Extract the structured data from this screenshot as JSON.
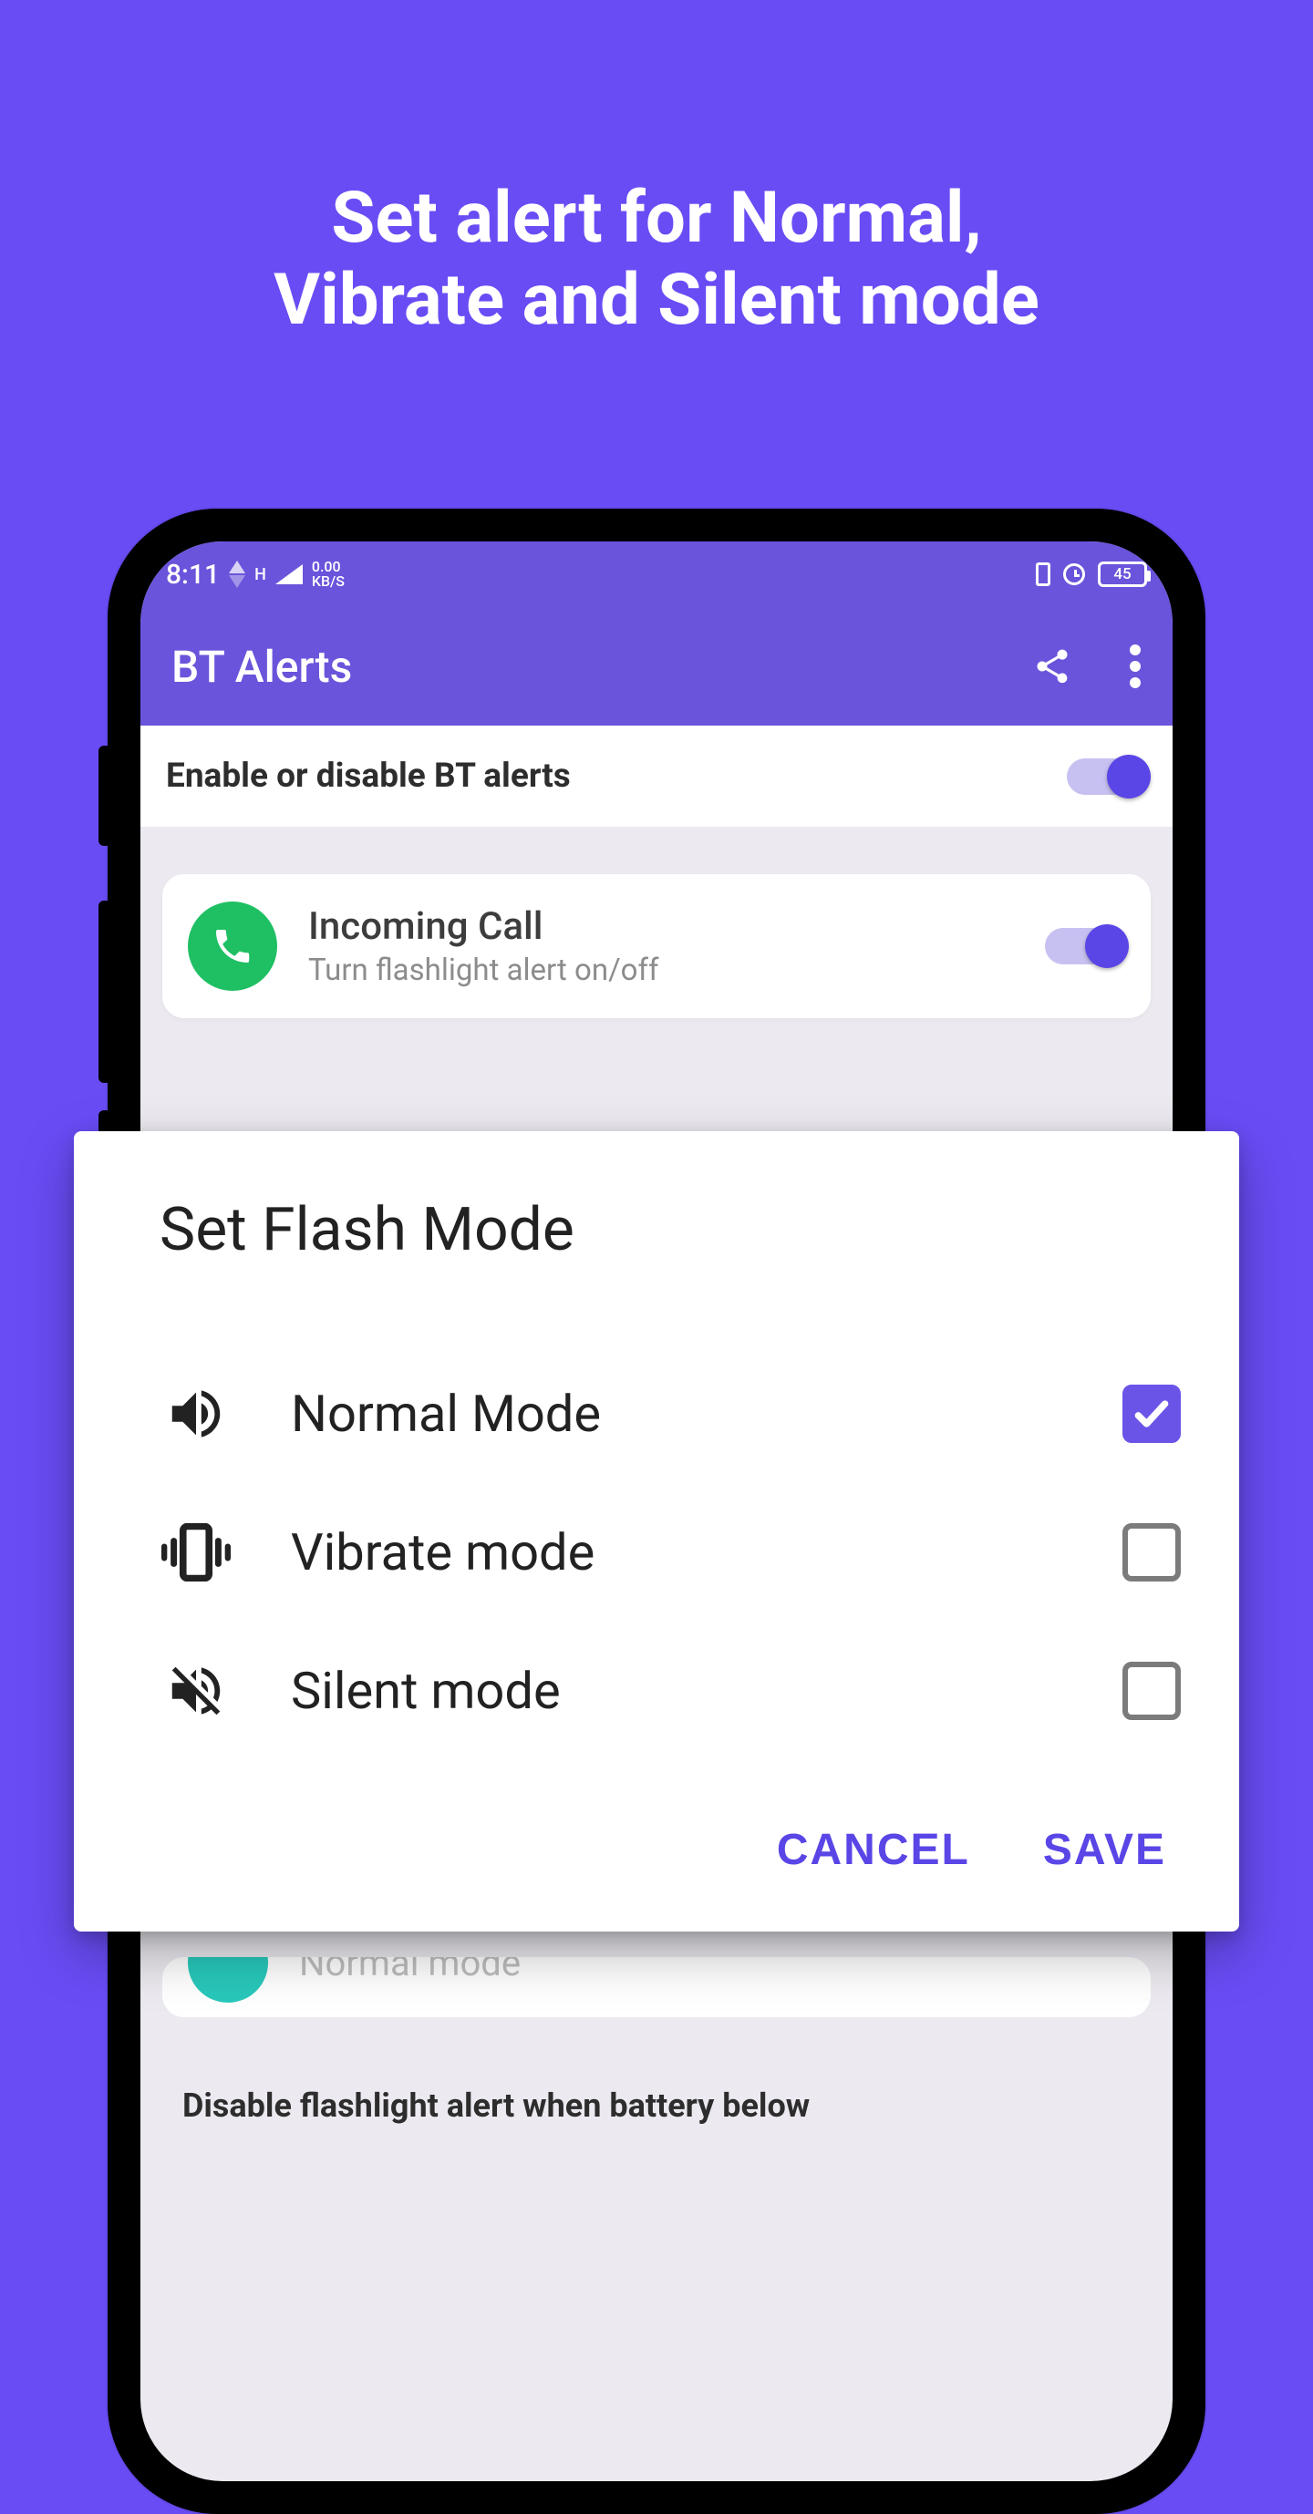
{
  "hero_line1": "Set alert for Normal,",
  "hero_line2": "Vibrate and Silent mode",
  "status": {
    "time": "8:11",
    "net_h": "H",
    "kbps_top": "0.00",
    "kbps_bot": "KB/S",
    "battery": "45"
  },
  "appbar": {
    "title": "BT Alerts"
  },
  "enable_row": {
    "label": "Enable or disable BT alerts"
  },
  "card_call": {
    "title": "Incoming Call",
    "subtitle": "Turn flashlight alert on/off"
  },
  "ghost_row": {
    "label": "Normal mode"
  },
  "battery_note": "Disable flashlight alert when battery below",
  "dialog": {
    "title": "Set Flash Mode",
    "options": [
      {
        "label": "Normal Mode",
        "checked": true
      },
      {
        "label": "Vibrate mode",
        "checked": false
      },
      {
        "label": "Silent mode",
        "checked": false
      }
    ],
    "cancel": "CANCEL",
    "save": "SAVE"
  }
}
